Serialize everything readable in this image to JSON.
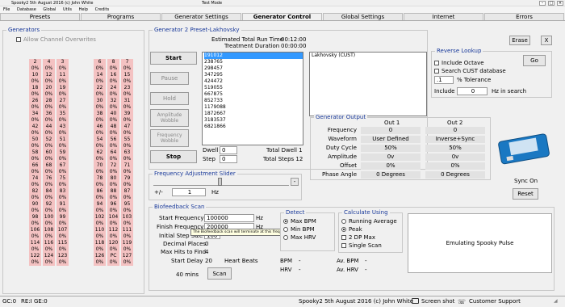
{
  "window": {
    "title": "Spooky2 5th August 2016 (c) John White",
    "mode": "Test Mode",
    "controls": [
      "–",
      "□",
      "×"
    ]
  },
  "menu": [
    "File",
    "Database",
    "Global",
    "Utils",
    "Help",
    "Credits"
  ],
  "tabs": [
    "Presets",
    "Programs",
    "Generator Settings",
    "Generator Control",
    "Global Settings",
    "Internet",
    "Errors"
  ],
  "generators_panel": {
    "title": "Generators",
    "allow_overwrites": "Allow Channel Overwrites",
    "columns": [
      [
        "2",
        "0%",
        "10",
        "0%",
        "18",
        "0%",
        "26",
        "0%",
        "34",
        "0%",
        "42",
        "0%",
        "50",
        "0%",
        "58",
        "0%",
        "66",
        "0%",
        "74",
        "0%",
        "82",
        "0%",
        "90",
        "0%",
        "98",
        "0%",
        "106",
        "0%",
        "114",
        "0%",
        "122",
        "0%"
      ],
      [
        "4",
        "0%",
        "12",
        "0%",
        "20",
        "0%",
        "28",
        "0%",
        "36",
        "0%",
        "44",
        "0%",
        "52",
        "0%",
        "60",
        "0%",
        "68",
        "0%",
        "76",
        "0%",
        "84",
        "0%",
        "92",
        "0%",
        "100",
        "0%",
        "108",
        "0%",
        "116",
        "0%",
        "124",
        "0%"
      ],
      [
        "3",
        "0%",
        "11",
        "0%",
        "19",
        "0%",
        "27",
        "0%",
        "35",
        "0%",
        "43",
        "0%",
        "51",
        "0%",
        "59",
        "0%",
        "67",
        "0%",
        "75",
        "0%",
        "83",
        "0%",
        "91",
        "0%",
        "99",
        "0%",
        "107",
        "0%",
        "115",
        "0%",
        "123",
        "0%"
      ],
      [
        "6",
        "0%",
        "14",
        "0%",
        "22",
        "0%",
        "30",
        "0%",
        "38",
        "0%",
        "46",
        "0%",
        "54",
        "0%",
        "62",
        "0%",
        "70",
        "0%",
        "78",
        "0%",
        "86",
        "0%",
        "94",
        "0%",
        "102",
        "0%",
        "110",
        "0%",
        "118",
        "0%",
        "126",
        "0%"
      ],
      [
        "8",
        "0%",
        "16",
        "0%",
        "24",
        "0%",
        "32",
        "0%",
        "40",
        "0%",
        "48",
        "0%",
        "56",
        "0%",
        "64",
        "0%",
        "72",
        "0%",
        "80",
        "0%",
        "88",
        "0%",
        "96",
        "0%",
        "104",
        "0%",
        "112",
        "0%",
        "120",
        "0%",
        "PC",
        "0%"
      ],
      [
        "7",
        "0%",
        "15",
        "0%",
        "23",
        "0%",
        "31",
        "0%",
        "39",
        "0%",
        "47",
        "0%",
        "55",
        "0%",
        "63",
        "0%",
        "71",
        "0%",
        "79",
        "0%",
        "87",
        "0%",
        "95",
        "0%",
        "103",
        "0%",
        "111",
        "0%",
        "119",
        "0%",
        "127",
        "0%"
      ]
    ]
  },
  "generator": {
    "title": "Generator 2  Preset-Lakhovsky",
    "est_run_label": "Estimated Total Run Time",
    "est_run_value": "00:12:00",
    "treatment_label": "Treatment Duration",
    "treatment_value": "00:00:00",
    "buttons": {
      "start": "Start",
      "pause": "Pause",
      "hold": "Hold",
      "amp_wobble": "Amplitude Wobble",
      "freq_wobble": "Frequency Wobble",
      "stop": "Stop"
    },
    "freq_list": [
      "191012",
      "238765",
      "298457",
      "347295",
      "424472",
      "519055",
      "667875",
      "852733",
      "1179088",
      "1872667",
      "3183537",
      "6821866"
    ],
    "program_list": [
      "Lakhovsky (CUST)"
    ],
    "dwell_label": "Dwell",
    "dwell_value": "0",
    "step_label": "Step",
    "step_value": "0",
    "total_dwell": "Total Dwell 1",
    "total_steps": "Total Steps 12"
  },
  "reverse_lookup": {
    "title": "Reverse Lookup",
    "include_octave": "Include Octave",
    "search_cust": "Search CUST database",
    "tolerance_value": ".1",
    "tolerance_label": "% Tolerance",
    "include_label": "Include",
    "include_value": "0",
    "hz_in_search": "Hz in search",
    "go": "Go"
  },
  "top_buttons": {
    "erase": "Erase",
    "close": "X"
  },
  "generator_output": {
    "title": "Generator Output",
    "out1": "Out 1",
    "out2": "Out 2",
    "rows": [
      {
        "label": "Frequency",
        "out1": "0",
        "out2": "0"
      },
      {
        "label": "Waveform",
        "out1": "User Defined",
        "out2": "Inverse+Sync"
      },
      {
        "label": "Duty Cycle",
        "out1": "50%",
        "out2": "50%"
      },
      {
        "label": "Amplitude",
        "out1": "0v",
        "out2": "0v"
      },
      {
        "label": "Offset",
        "out1": "0%",
        "out2": "0%"
      },
      {
        "label": "Phase Angle",
        "out1": "0 Degrees",
        "out2": "0 Degrees"
      }
    ]
  },
  "sync": {
    "label": "Sync On",
    "reset": "Reset"
  },
  "freq_slider": {
    "title": "Frequency Adjustment Slider",
    "plusminus": "+/-",
    "value": "1",
    "unit": "Hz",
    "arrow": "-"
  },
  "biofeedback": {
    "title": "Biofeedback Scan",
    "start_freq_label": "Start Frequency",
    "start_freq_value": "100000",
    "finish_freq_label": "Finish Frequency",
    "finish_freq_value": "200000",
    "initial_step_label": "Initial Step Size",
    "initial_step_value": "100",
    "decimal_label": "Decimal Places",
    "decimal_value": "0",
    "max_hits_label": "Max Hits to Find",
    "max_hits_value": "4",
    "start_delay_label": "Start Delay",
    "start_delay_value": "20",
    "heart_beats": "Heart Beats",
    "duration": "40 mins",
    "scan": "Scan",
    "hz": "Hz",
    "tooltip": "The Biofeedback scan will terminate at this frequency",
    "detect_title": "Detect",
    "detect_options": [
      "Max BPM",
      "Min BPM",
      "Max HRV"
    ],
    "calc_title": "Calculate Using",
    "calc_options": [
      "Running Average",
      "Peak",
      "2 DP Max",
      "Single Scan"
    ],
    "emulating": "Emulating Spooky Pulse",
    "bpm_label": "BPM",
    "bpm_value": "-",
    "hrv_label": "HRV",
    "hrv_value": "-",
    "av_bpm_label": "Av. BPM",
    "av_bpm_value": "-",
    "av_hrv_label": "Av. HRV",
    "av_hrv_value": "-"
  },
  "status": {
    "gc": "GC:0",
    "re": "RE:I",
    "ge": "GE:0",
    "center": "Spooky2 5th August 2016 (c) John White",
    "screenshot": "Screen shot",
    "support": "Customer Support"
  }
}
